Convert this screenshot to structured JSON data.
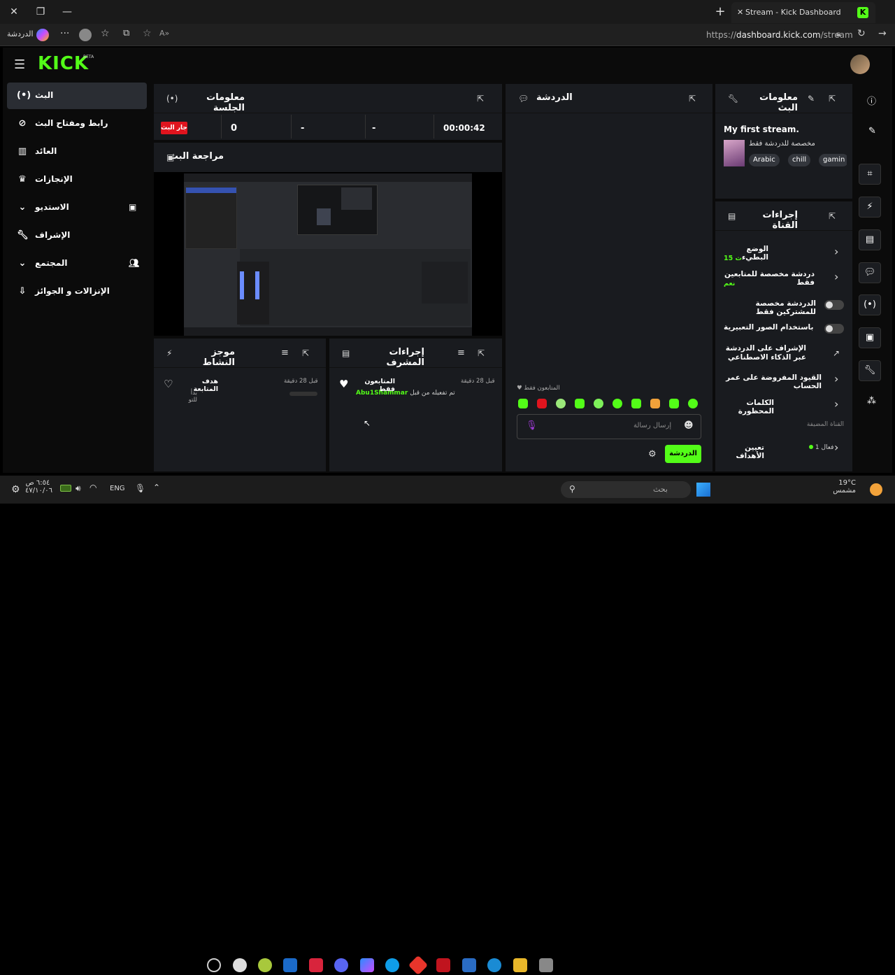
{
  "browser": {
    "tab_title": "Stream - Kick Dashboard",
    "url": "https://dashboard.kick.com/stream",
    "profile_label": "الدردشة",
    "url_host": "dashboard.kick.com",
    "url_scheme": "https://",
    "url_path": "/stream"
  },
  "header": {
    "logo": "KICK",
    "beta": "BETA"
  },
  "sidebar": {
    "items": [
      {
        "label": "البث",
        "icon": "broadcast-icon"
      },
      {
        "label": "رابط ومفتاح البث",
        "icon": "link-icon"
      },
      {
        "label": "العائد",
        "icon": "chart-icon"
      },
      {
        "label": "الإنجازات",
        "icon": "trophy-icon"
      },
      {
        "label": "الاستديو",
        "icon": "studio-icon"
      },
      {
        "label": "الإشراف",
        "icon": "wrench-icon"
      },
      {
        "label": "المجتمع",
        "icon": "users-icon"
      },
      {
        "label": "الإنزالات و الجوائز",
        "icon": "drops-icon"
      }
    ]
  },
  "session": {
    "title": "معلومات الجلسة",
    "live_badge": "جار البث",
    "stat1": "0",
    "stat2": "-",
    "stat3": "-",
    "duration": "00:00:42"
  },
  "preview": {
    "title": "مراجعة البث"
  },
  "activity": {
    "title": "موجز النشاط",
    "item_title": "هدف المتابعة",
    "item_sub": "بدأ للتو",
    "item_time": "قبل 28 دقيقة"
  },
  "modlog": {
    "title": "إجراءات المشرف",
    "item_title": "المتابعون فقط",
    "item_user": "Abu1Shammar",
    "item_action": "تم تفعيله من قبل",
    "item_time": "قبل 28 دقيقة"
  },
  "chat": {
    "title": "الدردشة",
    "followers_only": "المتابعون فقط",
    "input_placeholder": "إرسال رسالة",
    "send_label": "الدردشة"
  },
  "stream_info": {
    "title": "معلومات البث",
    "stream_title": "My first stream.",
    "category": "مخصصة للدردشة فقط",
    "tags": [
      "Arabic",
      "chill",
      "gamin"
    ]
  },
  "channel_actions": {
    "title": "إجراءات القناة",
    "slow_mode": "الوضع البطيء",
    "slow_mode_value": "15 ث",
    "followers_chat": "دردشة مخصصة للمتابعين فقط",
    "followers_chat_value": "نعم",
    "subscribers_chat": "الدردشة مخصصة للمشتركين فقط",
    "emote_chat": "دردشة باستخدام الصور التعبيرية..",
    "ai_mod": "الإشراف على الدردشة عبر الذكاء الاصطناعي",
    "account_age": "القيود المفروضة على عمر الحساب",
    "banned_words": "الكلمات المحظورة",
    "section_label": "القناة المضيفة",
    "goals": "تعيين الأهداف",
    "goals_status": "فعال 1"
  },
  "taskbar": {
    "search_placeholder": "بحث",
    "lang": "ENG",
    "time": "٦:٥٤ ص",
    "date": "٤٧/١٠/٠٦",
    "weather_temp": "19°C",
    "weather_desc": "مشمس"
  },
  "colors": {
    "accent": "#53fc18",
    "live": "#e0141e",
    "panel": "#191b1f"
  }
}
